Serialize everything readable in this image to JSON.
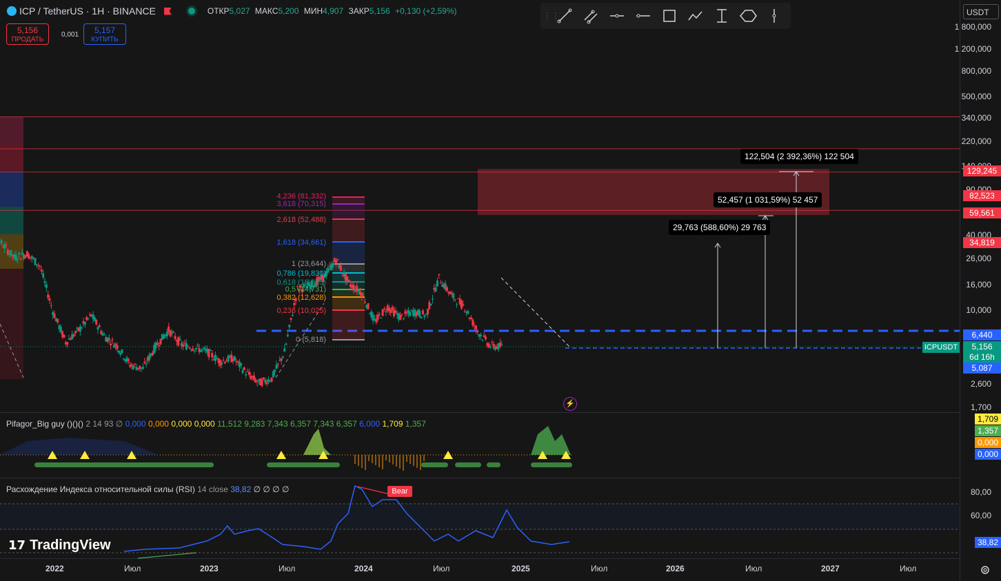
{
  "header": {
    "title": "ICP / TetherUS · 1H · BINANCE",
    "ohlc": [
      {
        "label": "ОТКР",
        "value": "5,027"
      },
      {
        "label": "МАКС",
        "value": "5,200"
      },
      {
        "label": "МИН",
        "value": "4,907"
      },
      {
        "label": "ЗАКР",
        "value": "5,156"
      }
    ],
    "change": "+0,130 (+2,59%)"
  },
  "trade": {
    "sell_price": "5,156",
    "sell_label": "ПРОДАТЬ",
    "spread": "0,001",
    "buy_price": "5,157",
    "buy_label": "КУПИТЬ"
  },
  "toolbar": {
    "tools": [
      "trend-line-icon",
      "parallel-channel-icon",
      "horizontal-ray-icon",
      "horizontal-line-icon",
      "rectangle-icon",
      "path-icon",
      "price-range-icon",
      "ellipse-icon",
      "vertical-line-icon"
    ]
  },
  "price_axis": {
    "currency": "USDT",
    "labels": [
      "1 800,000",
      "1 200,000",
      "800,000",
      "500,000",
      "340,000",
      "220,000",
      "140,000",
      "90,000",
      "40,000",
      "26,000",
      "16,000",
      "10,000",
      "2,600",
      "1,700"
    ],
    "tags": [
      {
        "value": "129,245",
        "color": "#f23645"
      },
      {
        "value": "82,523",
        "color": "#f23645"
      },
      {
        "value": "59,561",
        "color": "#f23645"
      },
      {
        "value": "34,819",
        "color": "#f23645"
      },
      {
        "value": "6,440",
        "color": "#2962ff"
      },
      {
        "value": "5,156",
        "color": "#089981"
      },
      {
        "value": "6d 16h",
        "color": "#089981"
      },
      {
        "value": "5,087",
        "color": "#2962ff"
      }
    ],
    "symbol_tag": "ICPUSDT"
  },
  "fib": [
    {
      "label": "4,236 (81,332)",
      "color": "#e91e63"
    },
    {
      "label": "3,618 (70,315)",
      "color": "#9c27b0"
    },
    {
      "label": "2,618 (52,488)",
      "color": "#f23645"
    },
    {
      "label": "1,618 (34,661)",
      "color": "#2962ff"
    },
    {
      "label": "1 (23,644)",
      "color": "#9598a1"
    },
    {
      "label": "0,786 (19,830)",
      "color": "#00bcd4"
    },
    {
      "label": "0,618 (16,835)",
      "color": "#089981"
    },
    {
      "label": "0,5 (14,731)",
      "color": "#4caf50"
    },
    {
      "label": "0,382 (12,628)",
      "color": "#ff9800"
    },
    {
      "label": "0,236 (10,025)",
      "color": "#f23645"
    },
    {
      "label": "0 (5,818)",
      "color": "#9598a1"
    }
  ],
  "measures": [
    {
      "text": "122,504 (2 392,36%) 122 504"
    },
    {
      "text": "52,457 (1 031,59%) 52 457"
    },
    {
      "text": "29,763 (588,60%) 29 763"
    }
  ],
  "indicator1": {
    "name": "Pifagor_Big guy ()()()",
    "params": "2 14 93",
    "empty_symbol": "∅",
    "values": [
      {
        "v": "0,000",
        "color": "#2962ff"
      },
      {
        "v": "0,000",
        "color": "#ff9800"
      },
      {
        "v": "0,000",
        "color": "#ffeb3b"
      },
      {
        "v": "0,000",
        "color": "#ffeb3b"
      },
      {
        "v": "11,512",
        "color": "#4caf50"
      },
      {
        "v": "9,283",
        "color": "#4caf50"
      },
      {
        "v": "7,343",
        "color": "#4caf50"
      },
      {
        "v": "6,357",
        "color": "#4caf50"
      },
      {
        "v": "7,343",
        "color": "#4caf50"
      },
      {
        "v": "6,357",
        "color": "#4caf50"
      },
      {
        "v": "6,000",
        "color": "#2962ff"
      },
      {
        "v": "1,709",
        "color": "#ffeb3b"
      },
      {
        "v": "1,357",
        "color": "#4caf50"
      }
    ],
    "tags": [
      {
        "value": "1,709",
        "color": "#ffeb3b",
        "text": "#000000"
      },
      {
        "value": "1,357",
        "color": "#4caf50",
        "text": "#ffffff"
      },
      {
        "value": "0,000",
        "color": "#ff9800",
        "text": "#ffffff"
      },
      {
        "value": "0,000",
        "color": "#2962ff",
        "text": "#ffffff"
      }
    ]
  },
  "indicator2": {
    "name": "Расхождение Индекса относительной силы (RSI)",
    "params": "14 close",
    "value": "38,82",
    "empty": "∅ ∅ ∅ ∅",
    "axis": [
      "80,00",
      "60,00"
    ],
    "tag": "38,82",
    "bear_label": "Bear"
  },
  "time_axis": [
    "2022",
    "Июл",
    "2023",
    "Июл",
    "2024",
    "Июл",
    "2025",
    "Июл",
    "2026",
    "Июл",
    "2027",
    "Июл"
  ],
  "logo": "TradingView",
  "chart_data": {
    "type": "candlestick",
    "symbol": "ICPUSDT",
    "y_scale": "log",
    "ylim": [
      1.7,
      1800
    ],
    "x_range": [
      "2021-10",
      "2027-09"
    ],
    "close_series": [
      {
        "t": "2021-11",
        "close": 35
      },
      {
        "t": "2021-12",
        "close": 28
      },
      {
        "t": "2022-01",
        "close": 22
      },
      {
        "t": "2022-02",
        "close": 18
      },
      {
        "t": "2022-03",
        "close": 19
      },
      {
        "t": "2022-04",
        "close": 16
      },
      {
        "t": "2022-05",
        "close": 8.5
      },
      {
        "t": "2022-06",
        "close": 5.5
      },
      {
        "t": "2022-07",
        "close": 6.5
      },
      {
        "t": "2022-08",
        "close": 8
      },
      {
        "t": "2022-09",
        "close": 6
      },
      {
        "t": "2022-10",
        "close": 5.2
      },
      {
        "t": "2022-11",
        "close": 4.0
      },
      {
        "t": "2022-12",
        "close": 3.8
      },
      {
        "t": "2023-01",
        "close": 5.2
      },
      {
        "t": "2023-02",
        "close": 6.5
      },
      {
        "t": "2023-03",
        "close": 5.3
      },
      {
        "t": "2023-04",
        "close": 5.1
      },
      {
        "t": "2023-05",
        "close": 4.8
      },
      {
        "t": "2023-06",
        "close": 4.2
      },
      {
        "t": "2023-07",
        "close": 4.4
      },
      {
        "t": "2023-08",
        "close": 3.6
      },
      {
        "t": "2023-09",
        "close": 3.1
      },
      {
        "t": "2023-10",
        "close": 3.3
      },
      {
        "t": "2023-11",
        "close": 4.8
      },
      {
        "t": "2023-12",
        "close": 11.5
      },
      {
        "t": "2024-01",
        "close": 12.2
      },
      {
        "t": "2024-02",
        "close": 13.5
      },
      {
        "t": "2024-03",
        "close": 17.5
      },
      {
        "t": "2024-04",
        "close": 12.5
      },
      {
        "t": "2024-05",
        "close": 11.0
      },
      {
        "t": "2024-06",
        "close": 7.3
      },
      {
        "t": "2024-07",
        "close": 9.0
      },
      {
        "t": "2024-08",
        "close": 7.8
      },
      {
        "t": "2024-09",
        "close": 8.4
      },
      {
        "t": "2024-10",
        "close": 8.0
      },
      {
        "t": "2024-11",
        "close": 13.5
      },
      {
        "t": "2024-12",
        "close": 10.5
      },
      {
        "t": "2025-01",
        "close": 9.0
      },
      {
        "t": "2025-02",
        "close": 6.4
      },
      {
        "t": "2025-03",
        "close": 5.2
      },
      {
        "t": "2025-04",
        "close": 5.156
      }
    ],
    "horizontal_lines": [
      129.245,
      82.523,
      59.561,
      34.819,
      6.44
    ],
    "current_price": 5.156
  }
}
